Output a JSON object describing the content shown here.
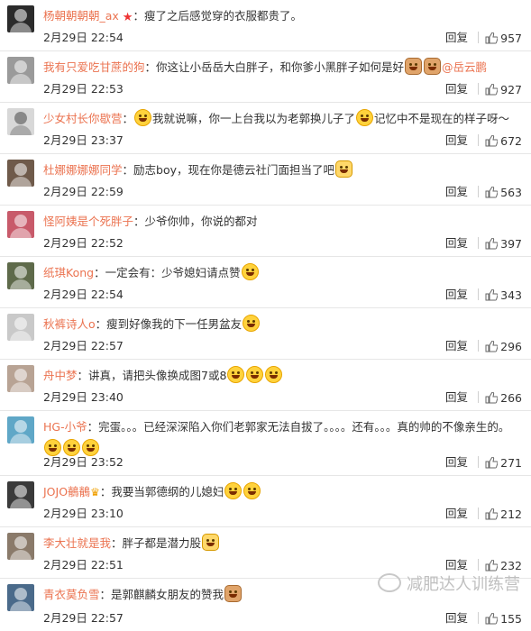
{
  "ui": {
    "reply_label": "回复",
    "sep": "："
  },
  "comments": [
    {
      "name": "杨朝朝朝朝_ax",
      "text": "瘦了之后感觉穿的衣服都贵了。",
      "time": "2月29日 22:54",
      "likes": "957",
      "avatar_color": "#2b2b2b",
      "badge": "vip"
    },
    {
      "name": "我有只爱吃甘蔗的狗",
      "text": "你这让小岳岳大白胖子，和你爹小黑胖子如何是好",
      "mention": "@岳云鹏",
      "time": "2月29日 22:53",
      "likes": "927",
      "avatar_color": "#9a9a9a"
    },
    {
      "name": "少女村长你歇营",
      "text": "我就说嘛，你一上台我以为老郭换儿子了",
      "text2": "记忆中不是现在的样子呀～",
      "time": "2月29日 23:37",
      "likes": "672",
      "avatar_color": "#d8d8d8"
    },
    {
      "name": "杜娜娜娜娜同学",
      "text": "励志boy，现在你是德云社门面担当了吧",
      "time": "2月29日 22:59",
      "likes": "563",
      "avatar_color": "#6f5a4a"
    },
    {
      "name": "怪阿姨是个死胖子",
      "text": "少爷你帅，你说的都对",
      "time": "2月29日 22:52",
      "likes": "397",
      "avatar_color": "#c85a6a"
    },
    {
      "name": "纸琪Kong",
      "text": "一定会有：少爷媳妇请点赞",
      "time": "2月29日 22:54",
      "likes": "343",
      "avatar_color": "#5e6a4a"
    },
    {
      "name": "秋裤诗人o",
      "text": "瘦到好像我的下一任男盆友",
      "time": "2月29日 22:57",
      "likes": "296",
      "avatar_color": "#c9c9c9"
    },
    {
      "name": "舟中梦",
      "text": "讲真，请把头像换成图7或8",
      "time": "2月29日 23:40",
      "likes": "266",
      "avatar_color": "#b8a394"
    },
    {
      "name": "HG-小爷",
      "text": "完蛋。。。已经深深陷入你们老郭家无法自拔了。。。。还有。。。真的帅的不像亲生的。",
      "time": "2月29日 23:52",
      "likes": "271",
      "avatar_color": "#5fa7c7"
    },
    {
      "name": "JOJO鶺鶺",
      "text": "我要当郭德纲的儿媳妇",
      "time": "2月29日 23:10",
      "likes": "212",
      "avatar_color": "#3a3a3a"
    },
    {
      "name": "李大壮就是我",
      "text": "胖子都是潜力股",
      "time": "2月29日 22:51",
      "likes": "232",
      "avatar_color": "#8a7a6a"
    },
    {
      "name": "青衣莫负雪",
      "text": "是郭麒麟女朋友的赞我",
      "time": "2月29日 22:57",
      "likes": "155",
      "avatar_color": "#4a6a8a"
    }
  ],
  "watermark": "减肥达人训练营",
  "colors": {
    "name": "#eb7350",
    "text": "#333333",
    "border": "#e6e6e6"
  }
}
